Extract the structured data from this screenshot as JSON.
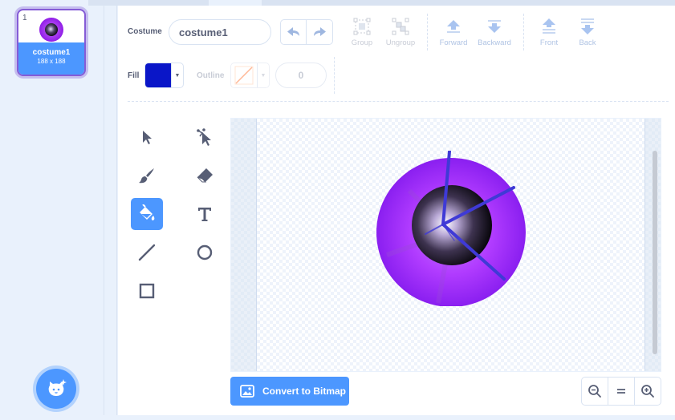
{
  "costume_list": {
    "items": [
      {
        "number": "1",
        "name": "costume1",
        "size": "188 x 188"
      }
    ]
  },
  "toolbar": {
    "costume_label": "Costume",
    "costume_name": "costume1",
    "group_label": "Group",
    "ungroup_label": "Ungroup",
    "forward_label": "Forward",
    "backward_label": "Backward",
    "front_label": "Front",
    "back_label": "Back",
    "fill_label": "Fill",
    "outline_label": "Outline",
    "outline_width": "0"
  },
  "colors": {
    "accent": "#4c97ff",
    "fill": "#0a16c8",
    "costume_selected_border": "#855cd6"
  },
  "tools": [
    "select-icon",
    "reshape-icon",
    "brush-icon",
    "eraser-icon",
    "fill-icon",
    "text-icon",
    "line-icon",
    "circle-icon",
    "rectangle-icon"
  ],
  "active_tool": "fill-icon",
  "convert_button": {
    "label": "Convert to Bitmap"
  },
  "zoom": {
    "out": "zoom-out-icon",
    "reset": "zoom-reset-icon",
    "in": "zoom-in-icon"
  }
}
